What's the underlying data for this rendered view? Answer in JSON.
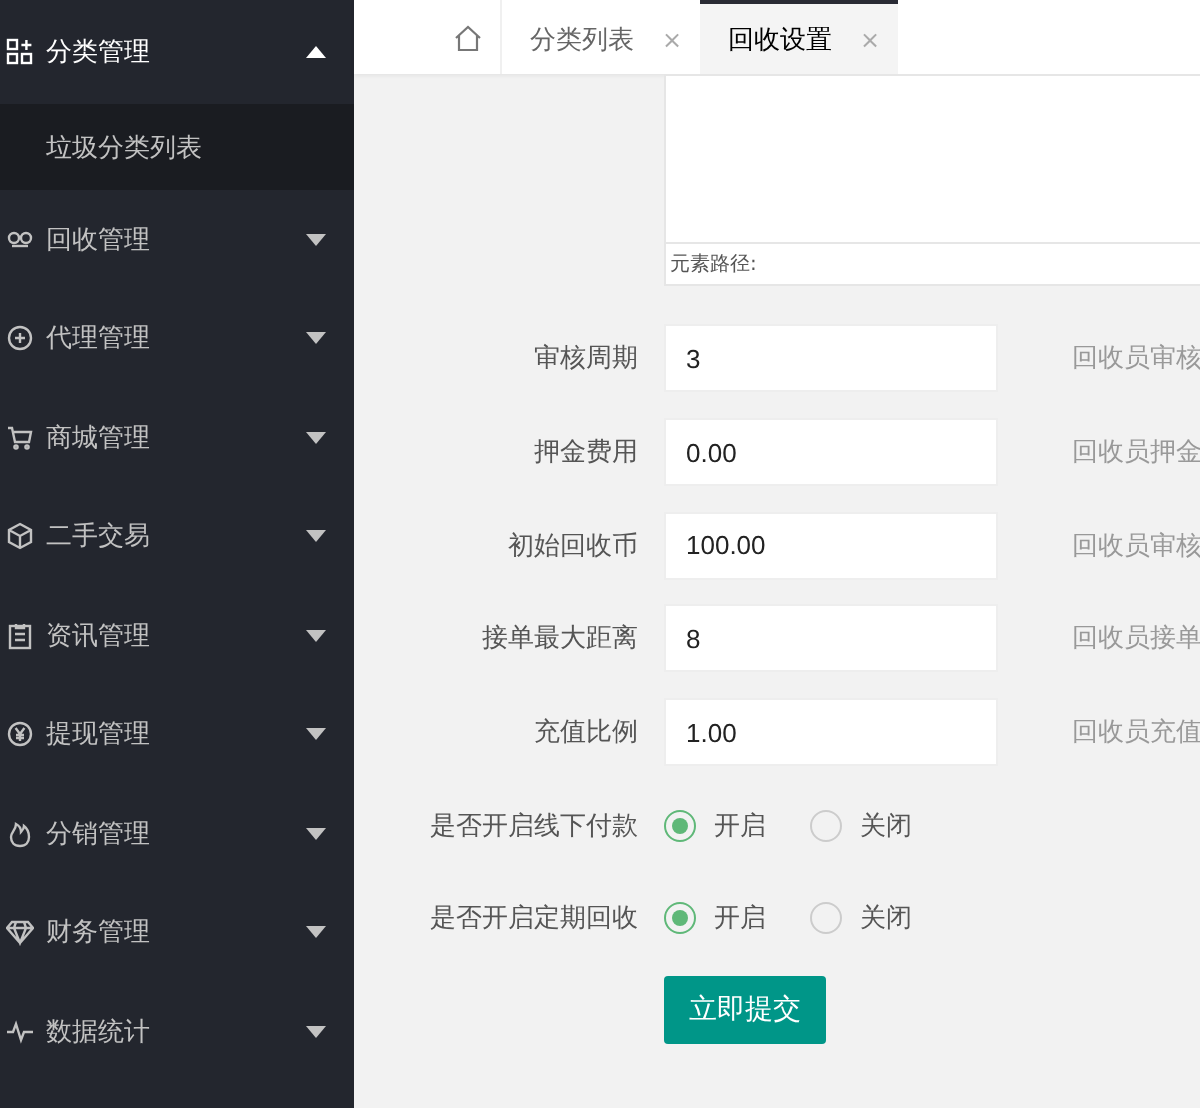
{
  "sidebar": {
    "items": [
      {
        "label": "分类管理",
        "expanded": true,
        "children": [
          {
            "label": "垃圾分类列表"
          }
        ]
      },
      {
        "label": "回收管理",
        "expanded": false
      },
      {
        "label": "代理管理",
        "expanded": false
      },
      {
        "label": "商城管理",
        "expanded": false
      },
      {
        "label": "二手交易",
        "expanded": false
      },
      {
        "label": "资讯管理",
        "expanded": false
      },
      {
        "label": "提现管理",
        "expanded": false
      },
      {
        "label": "分销管理",
        "expanded": false
      },
      {
        "label": "财务管理",
        "expanded": false
      },
      {
        "label": "数据统计",
        "expanded": false
      }
    ]
  },
  "tabs": [
    {
      "label": "分类列表",
      "close": "×",
      "selected": false
    },
    {
      "label": "回收设置",
      "close": "×",
      "selected": true
    }
  ],
  "editor": {
    "path_label": "元素路径:"
  },
  "form": {
    "fields": [
      {
        "kind": "input",
        "label": "审核周期",
        "value": "3",
        "hint": "回收员审核"
      },
      {
        "kind": "input",
        "label": "押金费用",
        "value": "0.00",
        "hint": "回收员押金"
      },
      {
        "kind": "input",
        "label": "初始回收币",
        "value": "100.00",
        "hint": "回收员审核"
      },
      {
        "kind": "input",
        "label": "接单最大距离",
        "value": "8",
        "hint": "回收员接单"
      },
      {
        "kind": "input",
        "label": "充值比例",
        "value": "1.00",
        "hint": "回收员充值"
      },
      {
        "kind": "radio",
        "label": "是否开启线下付款",
        "options": [
          {
            "label": "开启",
            "selected": true
          },
          {
            "label": "关闭",
            "selected": false
          }
        ]
      },
      {
        "kind": "radio",
        "label": "是否开启定期回收",
        "options": [
          {
            "label": "开启",
            "selected": true
          },
          {
            "label": "关闭",
            "selected": false
          }
        ]
      }
    ],
    "submit": "立即提交"
  }
}
